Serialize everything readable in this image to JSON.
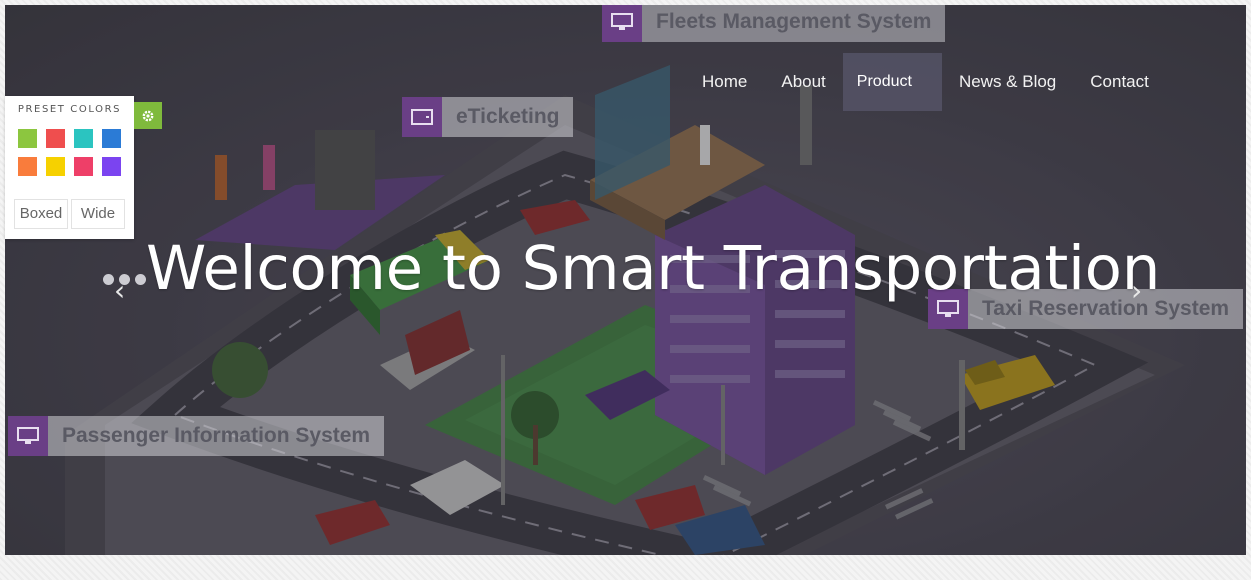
{
  "nav": {
    "items": [
      {
        "label": "Home",
        "active": false
      },
      {
        "label": "About",
        "active": false
      },
      {
        "label": "Product",
        "active": true
      },
      {
        "label": "News & Blog",
        "active": false
      },
      {
        "label": "Contact",
        "active": false
      }
    ]
  },
  "hero": {
    "title": "Welcome to Smart Transportation",
    "prev_icon": "chevron-left-icon",
    "next_icon": "chevron-right-icon",
    "slide_dots": 3
  },
  "signs": {
    "fleets": "Fleets Management System",
    "eticketing": "eTicketing",
    "taxi": "Taxi Reservation System",
    "passenger": "Passenger Information System"
  },
  "preset_panel": {
    "title": "PRESET COLORS",
    "colors": [
      "#8cc63f",
      "#ef4e4e",
      "#2bc4c0",
      "#2b7bd6",
      "#f97c3c",
      "#f6d100",
      "#ee3f68",
      "#7b44f0"
    ],
    "boxed_label": "Boxed",
    "wide_label": "Wide",
    "toggle_icon": "gear-icon",
    "toggle_color": "#7fba3c"
  },
  "colors": {
    "sign_accent": "#6a3f86",
    "nav_active_bg": "#5a586e"
  }
}
